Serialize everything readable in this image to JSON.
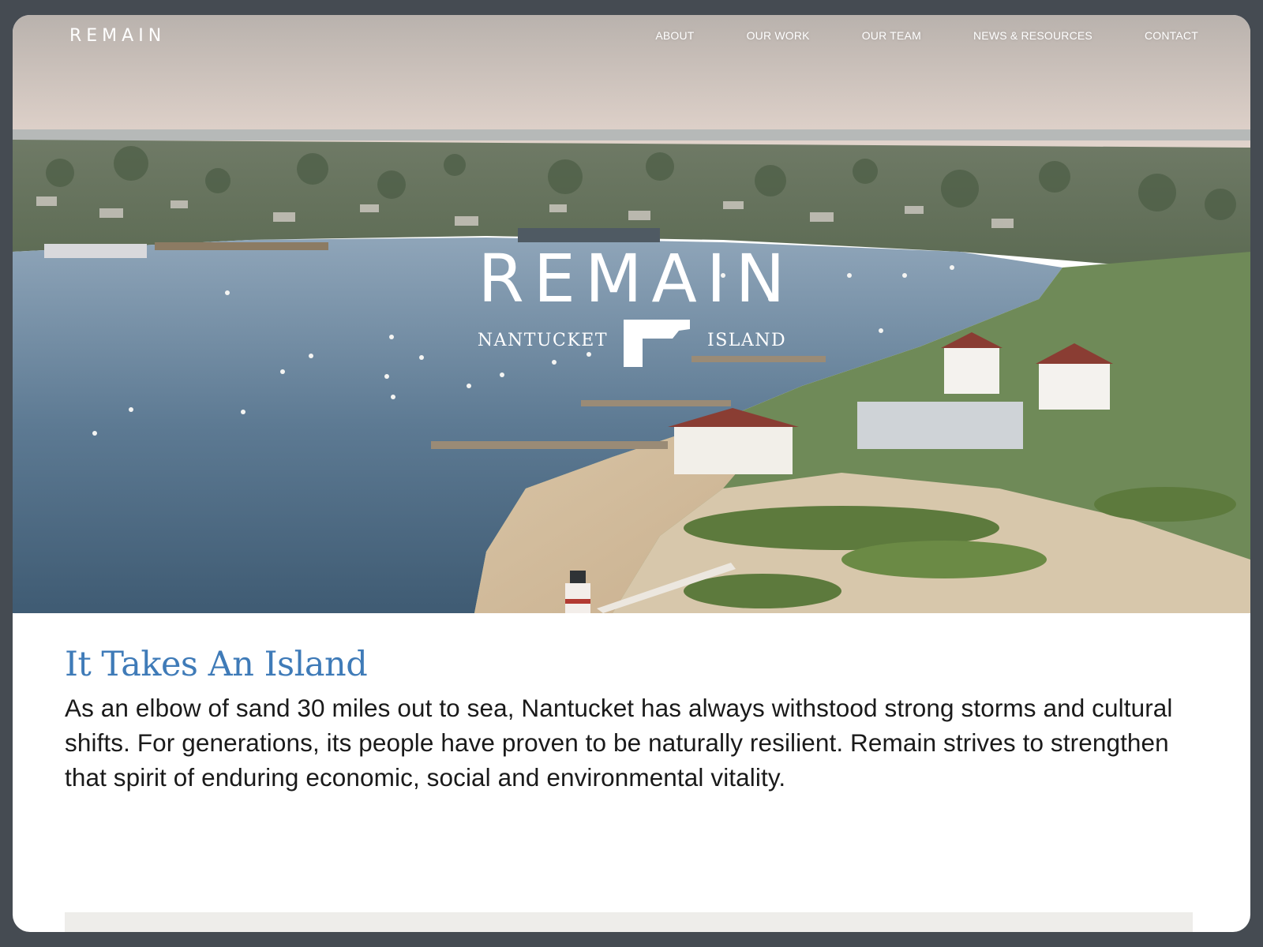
{
  "header": {
    "brand": "REMAIN",
    "nav": [
      {
        "label": "ABOUT"
      },
      {
        "label": "OUR WORK"
      },
      {
        "label": "OUR TEAM"
      },
      {
        "label": "NEWS & RESOURCES"
      },
      {
        "label": "CONTACT"
      }
    ]
  },
  "hero": {
    "logo_word": "REMAIN",
    "logo_left": "NANTUCKET",
    "logo_right": "ISLAND"
  },
  "intro": {
    "headline": "It Takes An Island",
    "body": "As an elbow of sand 30 miles out to sea, Nantucket has always withstood strong storms and cultural shifts. For generations, its people have proven to be naturally resilient. Remain strives to strengthen that spirit of enduring economic, social and environmental vitality."
  },
  "colors": {
    "frame": "#454b52",
    "headline": "#3f7bb8",
    "text": "#1a1a1a",
    "band": "#eeedea"
  }
}
